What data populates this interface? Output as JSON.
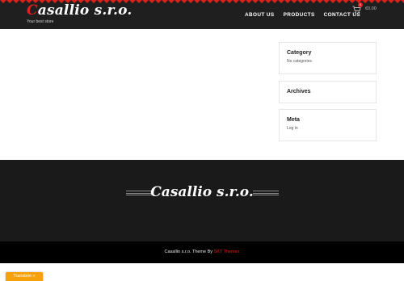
{
  "header": {
    "logo_first": "C",
    "logo_rest": "asallio s.r.o.",
    "tagline": "Your best store",
    "nav": [
      "ABOUT US",
      "PRODUCTS",
      "CONTACT US"
    ],
    "cart_count": "0",
    "cart_total": "€0.00"
  },
  "sidebar": {
    "category": {
      "title": "Category",
      "text": "No categories"
    },
    "archives": {
      "title": "Archives"
    },
    "meta": {
      "title": "Meta",
      "link": "Log in"
    }
  },
  "footer": {
    "title": "Casallio s.r.o.",
    "credits_prefix": "Casallio s.r.o. Theme By ",
    "credits_link": "SKT Themes"
  },
  "translate": {
    "label": "Translate »"
  },
  "colors": {
    "accent": "#e0201d",
    "header_bg": "#1f1f1f",
    "footer_bg": "#1a1a1a",
    "translate_bg": "#f4a10b"
  }
}
